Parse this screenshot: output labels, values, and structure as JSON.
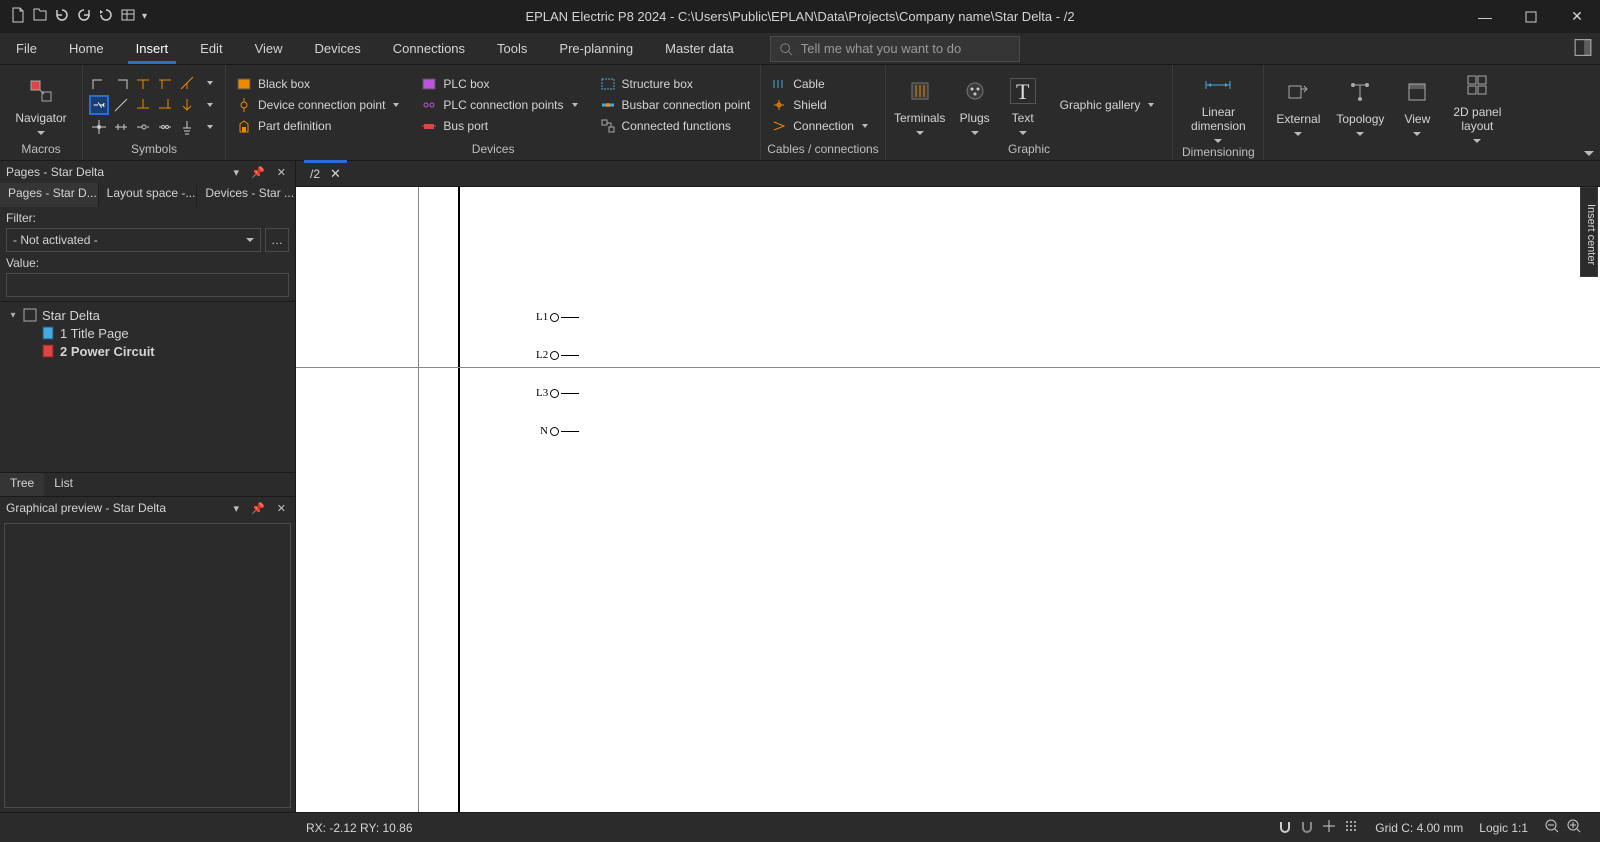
{
  "title": "EPLAN Electric P8 2024 - C:\\Users\\Public\\EPLAN\\Data\\Projects\\Company name\\Star Delta - /2",
  "menu": {
    "items": [
      "File",
      "Home",
      "Insert",
      "Edit",
      "View",
      "Devices",
      "Connections",
      "Tools",
      "Pre-planning",
      "Master data"
    ],
    "active": 2
  },
  "search_placeholder": "Tell me what you want to do",
  "ribbon": {
    "groups": {
      "macros": {
        "title": "Macros",
        "navigator": "Navigator"
      },
      "symbols": {
        "title": "Symbols"
      },
      "devices": {
        "title": "Devices",
        "black_box": "Black box",
        "device_conn_point": "Device connection point",
        "part_def": "Part definition",
        "plc_box": "PLC box",
        "plc_conn_points": "PLC connection points",
        "bus_port": "Bus port",
        "structure_box": "Structure box",
        "busbar_conn_point": "Busbar connection point",
        "connected_functions": "Connected functions"
      },
      "cables": {
        "title": "Cables / connections",
        "cable": "Cable",
        "shield": "Shield",
        "connection": "Connection"
      },
      "terminals": "Terminals",
      "plugs": "Plugs",
      "text": "Text",
      "graphic_gallery": "Graphic gallery",
      "graphic_title": "Graphic",
      "dimensioning_title": "Dimensioning",
      "linear_dimension": "Linear dimension",
      "external": "External",
      "topology": "Topology",
      "view": "View",
      "panel_layout": "2D panel layout"
    }
  },
  "pages_panel": {
    "title": "Pages - Star Delta",
    "subtabs": [
      "Pages - Star D...",
      "Layout space -...",
      "Devices - Star ..."
    ],
    "filter_label": "Filter:",
    "filter_value": "- Not activated -",
    "value_label": "Value:",
    "tree": {
      "root": "Star Delta",
      "items": [
        {
          "text": "1 Title Page",
          "bold": false
        },
        {
          "text": "2 Power Circuit",
          "bold": true
        }
      ]
    },
    "bottom_tabs": [
      "Tree",
      "List"
    ]
  },
  "preview_title": "Graphical preview - Star Delta",
  "editor": {
    "tabs": [
      {
        "label": "/2"
      }
    ],
    "terminals": [
      "L1",
      "L2",
      "L3",
      "N"
    ]
  },
  "right_bar": "Insert center",
  "status": {
    "coords": "RX: -2.12 RY: 10.86",
    "grid": "Grid C: 4.00 mm",
    "logic": "Logic 1:1"
  }
}
